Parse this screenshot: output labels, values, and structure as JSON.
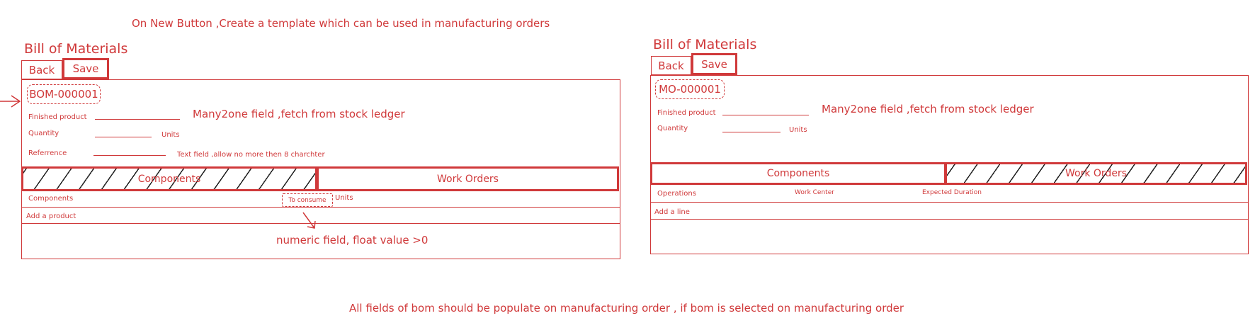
{
  "top_note": "On New Button ,Create a template which can be used in manufacturing orders",
  "bottom_note": "All fields of bom should be populate on manufacturing order , if bom is selected on manufacturing order",
  "left": {
    "title": "Bill of Materials",
    "back": "Back",
    "save": "Save",
    "ref_id": "BOM-000001",
    "finished_product_label": "Finished product",
    "quantity_label": "Quantity",
    "units": "Units",
    "reference_label": "Referrence",
    "many2one_note": "Many2one field ,fetch from stock ledger",
    "text_field_note": "Text field ,allow no more then 8 charchter",
    "tab_components": "Components",
    "tab_work_orders": "Work Orders",
    "col_components": "Components",
    "col_to_consume": "To consume",
    "col_units": "Units",
    "add_product": "Add a product",
    "numeric_note": "numeric field, float value >0"
  },
  "right": {
    "title": "Bill of Materials",
    "back": "Back",
    "save": "Save",
    "ref_id": "MO-000001",
    "finished_product_label": "Finished product",
    "quantity_label": "Quantity",
    "units": "Units",
    "many2one_note": "Many2one field ,fetch from stock ledger",
    "tab_components": "Components",
    "tab_work_orders": "Work Orders",
    "col_operations": "Operations",
    "col_work_center": "Work Center",
    "col_expected_duration": "Expected Duration",
    "add_line": "Add a line"
  },
  "colors": {
    "sketch_red": "#d0393a",
    "hatch": "#222222"
  }
}
